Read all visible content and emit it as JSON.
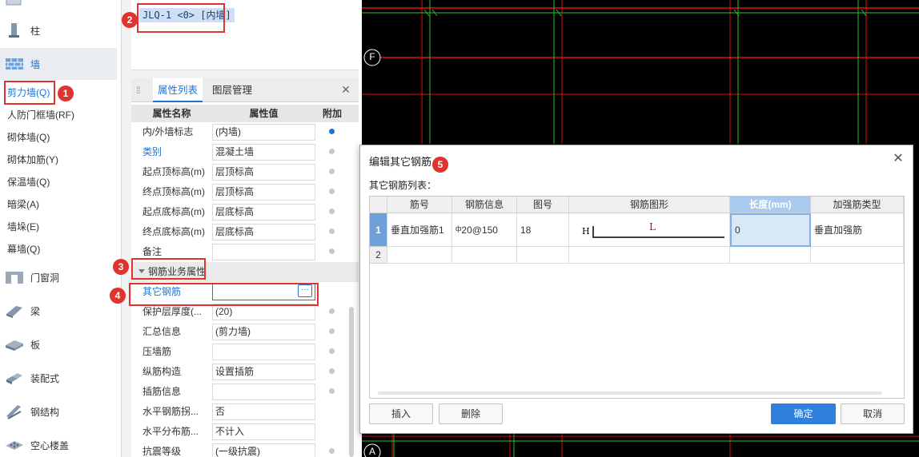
{
  "nav": {
    "items": [
      {
        "label": "柱",
        "icon": "column-icon"
      },
      {
        "label": "墙",
        "icon": "wall-icon"
      },
      {
        "label": "门窗洞",
        "icon": "door-window-icon"
      },
      {
        "label": "梁",
        "icon": "beam-icon"
      },
      {
        "label": "板",
        "icon": "slab-icon"
      },
      {
        "label": "装配式",
        "icon": "prefab-icon"
      },
      {
        "label": "钢结构",
        "icon": "steel-structure-icon"
      },
      {
        "label": "空心楼盖",
        "icon": "hollow-floor-icon"
      }
    ],
    "wall_sub": [
      "剪力墙(Q)",
      "人防门框墙(RF)",
      "砌体墙(Q)",
      "砌体加筋(Y)",
      "保温墙(Q)",
      "暗梁(A)",
      "墙垛(E)",
      "幕墙(Q)"
    ]
  },
  "component_list": {
    "selected": "JLQ-1 <0> [内墙]"
  },
  "property_panel": {
    "tabs": [
      "属性列表",
      "图层管理"
    ],
    "headers": [
      "属性名称",
      "属性值",
      "附加"
    ],
    "rows_a": [
      {
        "name": "内/外墙标志",
        "value": "(内墙)"
      },
      {
        "name": "类别",
        "value": "混凝土墙"
      },
      {
        "name": "起点顶标高(m)",
        "value": "层顶标高"
      },
      {
        "name": "终点顶标高(m)",
        "value": "层顶标高"
      },
      {
        "name": "起点底标高(m)",
        "value": "层底标高"
      },
      {
        "name": "终点底标高(m)",
        "value": "层底标高"
      },
      {
        "name": "备注",
        "value": ""
      }
    ],
    "group": "钢筋业务属性",
    "other_rebar": {
      "name": "其它钢筋",
      "value": "",
      "button": "···"
    },
    "rows_b": [
      {
        "name": "保护层厚度(...",
        "value": "(20)"
      },
      {
        "name": "汇总信息",
        "value": "(剪力墙)"
      },
      {
        "name": "压墙筋",
        "value": ""
      },
      {
        "name": "纵筋构造",
        "value": "设置插筋"
      },
      {
        "name": "插筋信息",
        "value": ""
      },
      {
        "name": "水平钢筋拐...",
        "value": "否"
      },
      {
        "name": "水平分布筋...",
        "value": "不计入"
      },
      {
        "name": "抗震等级",
        "value": "(一级抗震)"
      }
    ]
  },
  "canvas": {
    "axis_labels": [
      "F",
      "A"
    ]
  },
  "dialog": {
    "title": "编辑其它钢筋",
    "sublabel": "其它钢筋列表：",
    "columns": [
      "筋号",
      "钢筋信息",
      "图号",
      "钢筋图形",
      "长度(mm)",
      "加强筋类型"
    ],
    "rows": [
      {
        "index": "1",
        "bar_no": "垂直加强筋1",
        "info": "ɸ 20@150",
        "info_text": "20@150",
        "info_grade": "ф",
        "fig_no": "18",
        "shape_h": "H",
        "shape_l": "L",
        "length": "0",
        "type": "垂直加强筋"
      },
      {
        "index": "2"
      }
    ],
    "buttons": {
      "insert": "插入",
      "delete": "删除",
      "ok": "确定",
      "cancel": "取消"
    }
  },
  "callouts": [
    "1",
    "2",
    "3",
    "4",
    "5"
  ]
}
